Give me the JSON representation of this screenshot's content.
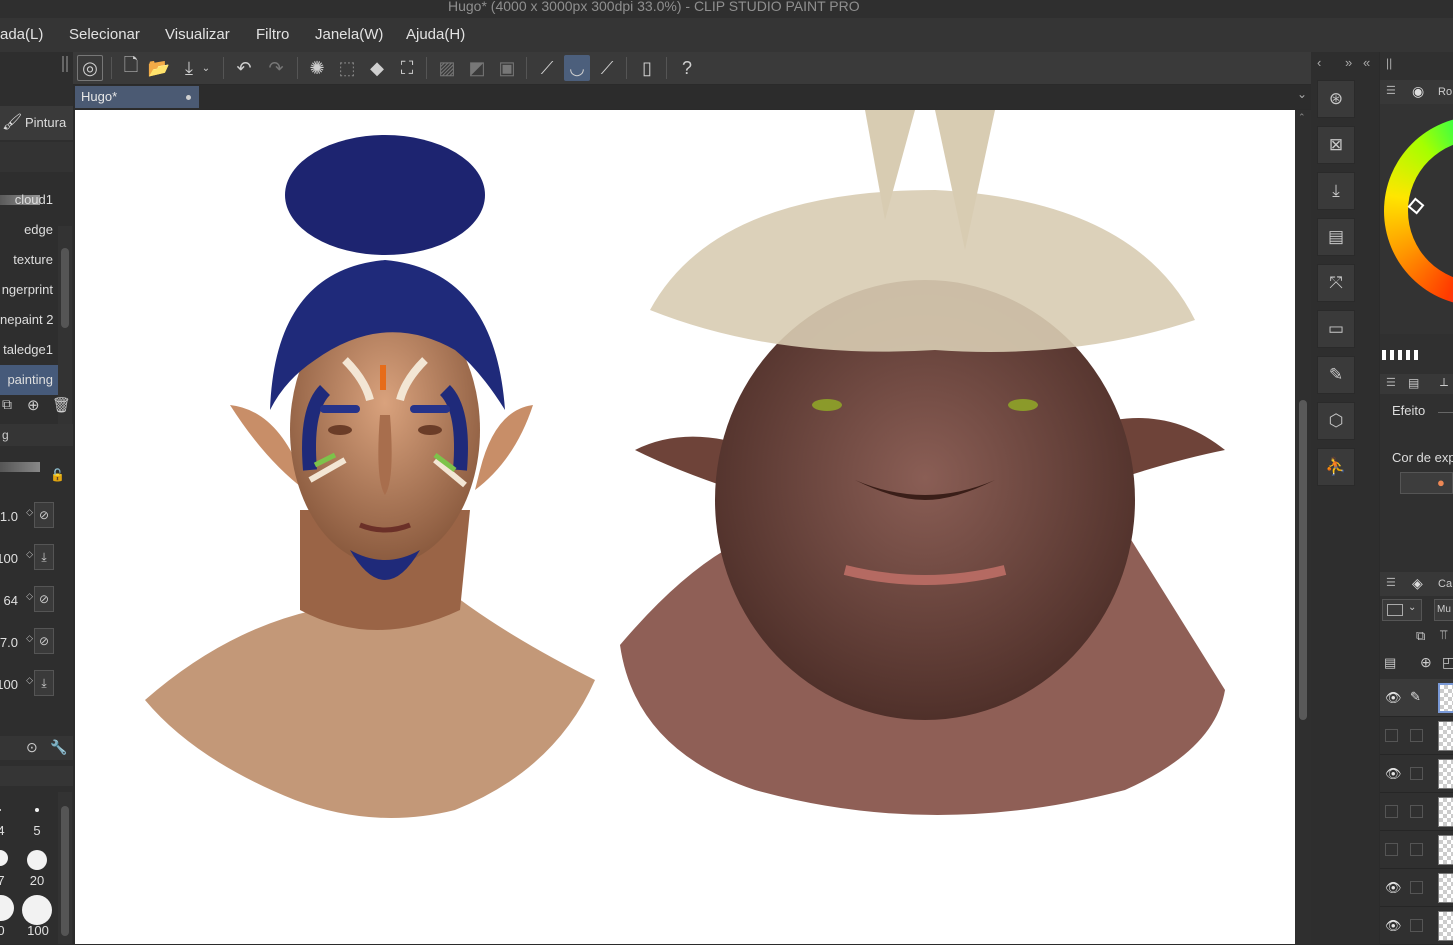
{
  "window": {
    "title": "Hugo* (4000 x 3000px 300dpi 33.0%)  - CLIP STUDIO PAINT PRO"
  },
  "menu": {
    "items": [
      "ada(L)",
      "Selecionar",
      "Visualizar",
      "Filtro",
      "Janela(W)",
      "Ajuda(H)"
    ]
  },
  "document": {
    "tab_label": "Hugo*"
  },
  "tool_panel": {
    "title": "Pintura",
    "brushes": [
      "cloud1",
      "edge",
      "texture",
      "ngerprint",
      "nepaint 2",
      "taledge1",
      "painting"
    ],
    "section_label": "g",
    "properties": [
      "1.0",
      "100",
      "64",
      "7.0",
      "100"
    ]
  },
  "brush_sizes": [
    "4",
    "5",
    "7",
    "20",
    "0",
    "100"
  ],
  "right_panel": {
    "color_tab": "Ro",
    "effect_label": "Efeito",
    "expression_color_label": "Cor de exp",
    "layer_tab": "Ca",
    "blend_mode": "Mu"
  },
  "colors": {
    "main_color": "#3a2220",
    "sub_color": "#f08a70",
    "accent": "#4b5a73"
  }
}
